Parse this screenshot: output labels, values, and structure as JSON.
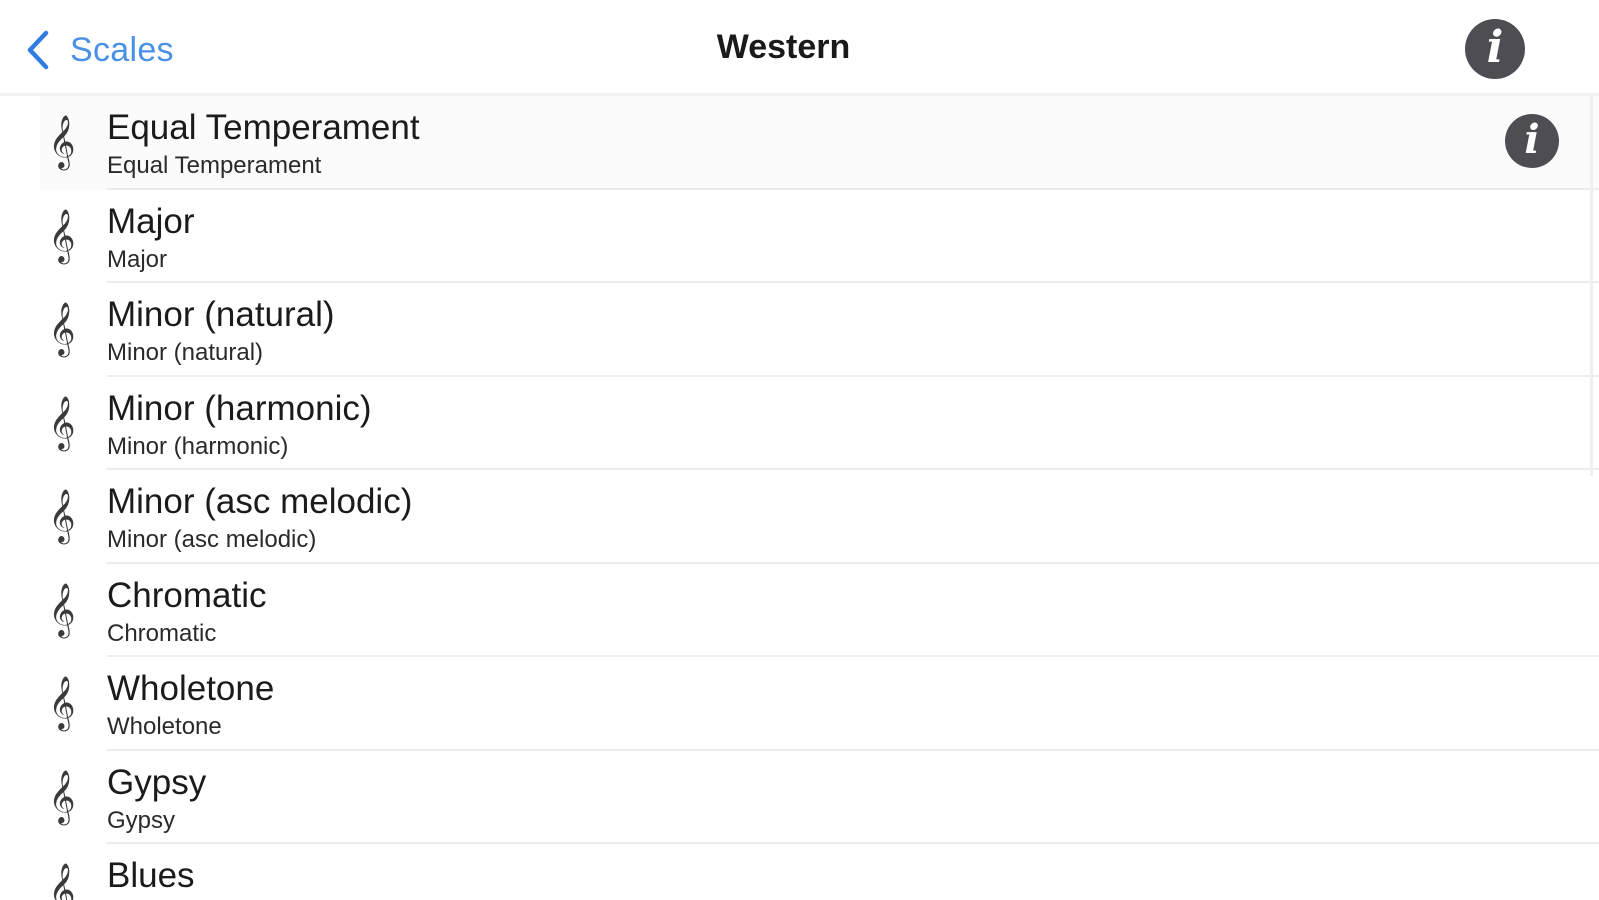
{
  "navbar": {
    "back_label": "Scales",
    "title": "Western",
    "info_glyph": "i"
  },
  "rows": [
    {
      "title": "Equal Temperament",
      "subtitle": "Equal Temperament",
      "icon": "treble-clef-icon",
      "info_glyph": "i"
    },
    {
      "title": "Major",
      "subtitle": "Major",
      "icon": "treble-clef-icon"
    },
    {
      "title": "Minor (natural)",
      "subtitle": "Minor (natural)",
      "icon": "treble-clef-icon"
    },
    {
      "title": "Minor (harmonic)",
      "subtitle": "Minor (harmonic)",
      "icon": "treble-clef-icon"
    },
    {
      "title": "Minor (asc melodic)",
      "subtitle": "Minor (asc melodic)",
      "icon": "treble-clef-icon"
    },
    {
      "title": "Chromatic",
      "subtitle": "Chromatic",
      "icon": "treble-clef-icon"
    },
    {
      "title": "Wholetone",
      "subtitle": "Wholetone",
      "icon": "treble-clef-icon"
    },
    {
      "title": "Gypsy",
      "subtitle": "Gypsy",
      "icon": "treble-clef-icon"
    },
    {
      "title": "Blues",
      "subtitle": "",
      "icon": "treble-clef-icon"
    }
  ],
  "colors": {
    "accent": "#4a90e6",
    "info_button": "#4e4e52",
    "divider": "#ececee"
  }
}
